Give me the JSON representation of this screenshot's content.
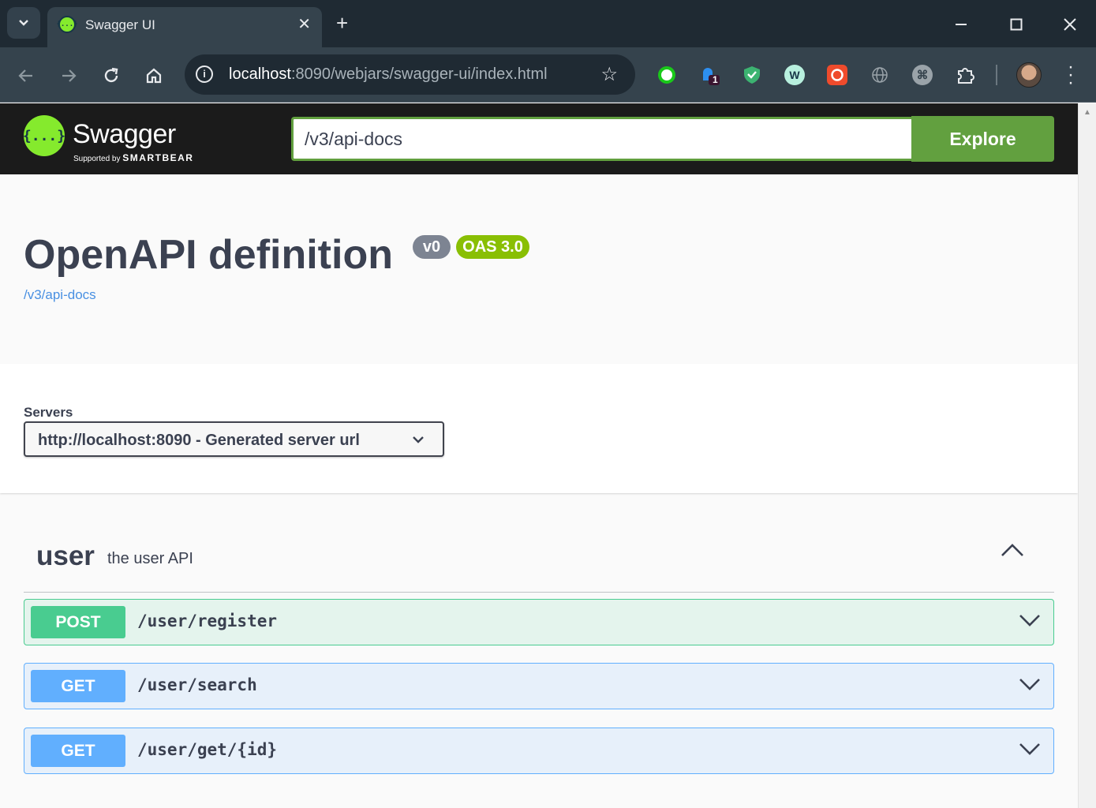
{
  "browser": {
    "tab_title": "Swagger UI",
    "tab_favicon_glyph": "{...}",
    "address": {
      "host": "localhost",
      "path": ":8090/webjars/swagger-ui/index.html"
    },
    "extension_badge_count": "1"
  },
  "topbar": {
    "logo_glyph": "{...}",
    "logo_name": "Swagger",
    "logo_supported_by": "Supported by",
    "logo_company": "SMARTBEAR",
    "url_value": "/v3/api-docs",
    "explore_label": "Explore",
    "bg_color": "#1b1b1b",
    "accent_color": "#62a03f"
  },
  "info": {
    "title": "OpenAPI definition",
    "version": "v0",
    "oas": "OAS 3.0",
    "spec_link": "/v3/api-docs"
  },
  "servers": {
    "label": "Servers",
    "selected": "http://localhost:8090 - Generated server url"
  },
  "tag": {
    "name": "user",
    "description": "the user API",
    "expanded": true
  },
  "operations": [
    {
      "method": "POST",
      "path": "/user/register",
      "color": "#49cc90"
    },
    {
      "method": "GET",
      "path": "/user/search",
      "color": "#61affe"
    },
    {
      "method": "GET",
      "path": "/user/get/{id}",
      "color": "#61affe"
    }
  ]
}
